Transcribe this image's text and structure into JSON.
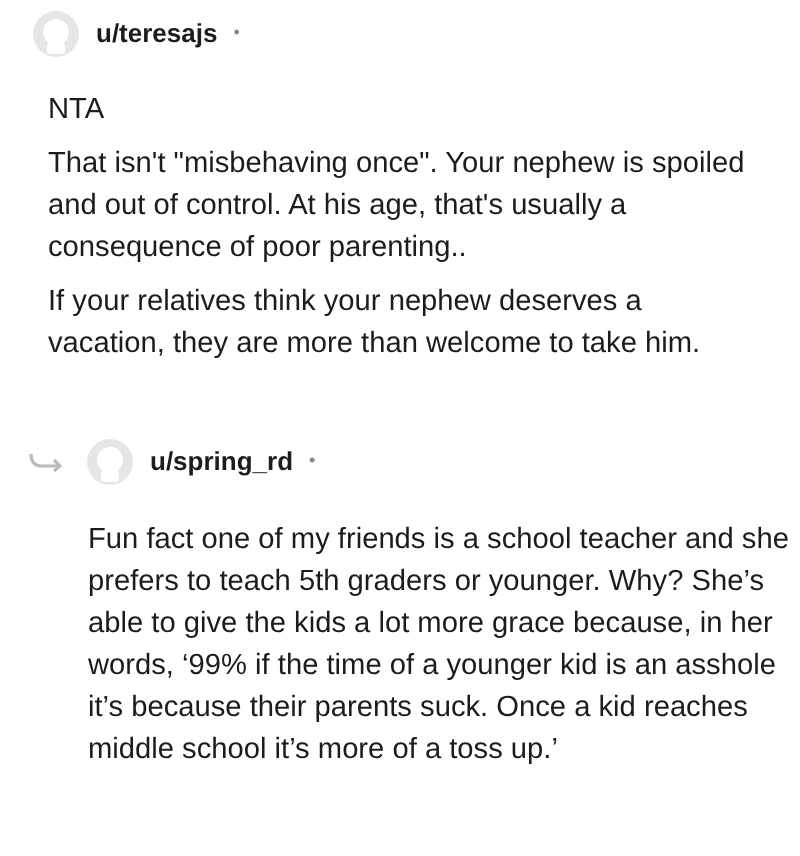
{
  "comments": [
    {
      "username": "u/teresajs",
      "separator": "•",
      "is_reply": false,
      "paragraphs": [
        "NTA",
        "That isn't \"misbehaving once\". Your nephew is spoiled and out of control. At his age, that's usually a consequence of poor parenting..",
        "If your relatives think your nephew deserves a vacation, they are more than welcome to take him."
      ]
    },
    {
      "username": "u/spring_rd",
      "separator": "•",
      "is_reply": true,
      "paragraphs": [
        "Fun fact one of my friends is a school teacher and she prefers to teach 5th graders or younger. Why? She’s able to give the kids a lot more grace because, in her words, ‘99% if the time of a younger kid is an asshole it’s because their parents suck. Once a kid reaches middle school it’s more of a toss up.’"
      ]
    }
  ]
}
